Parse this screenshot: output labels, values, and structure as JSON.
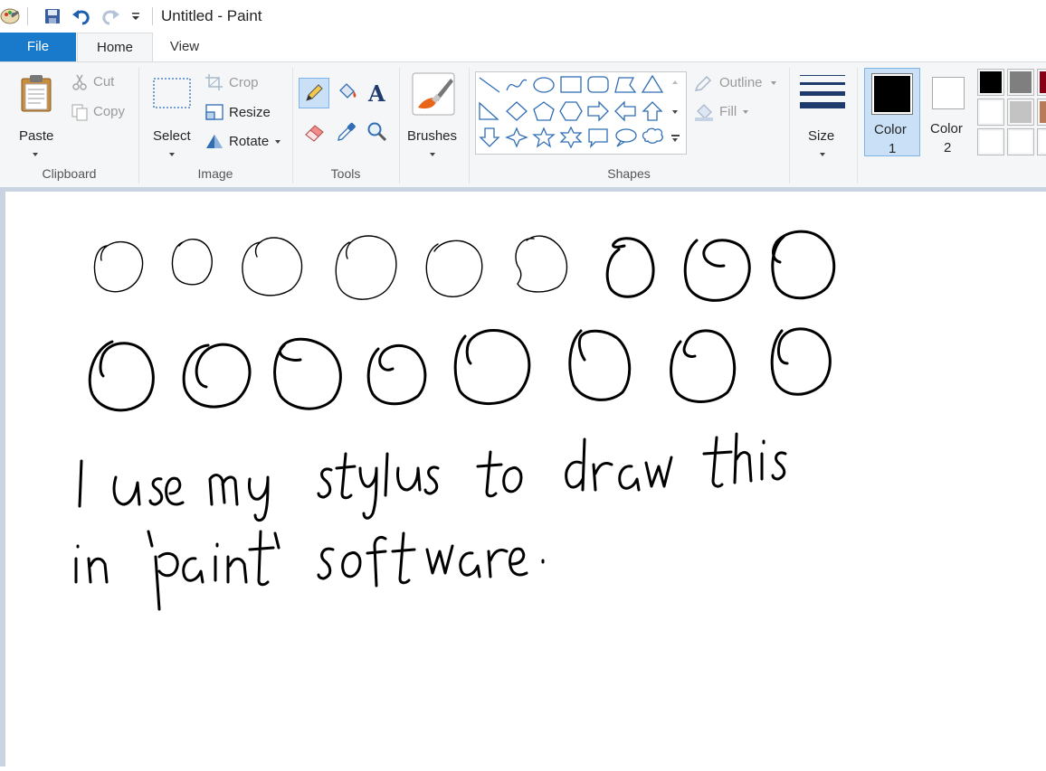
{
  "window": {
    "title": "Untitled - Paint"
  },
  "quick_access": {
    "icons": [
      "paint-app-icon",
      "save-icon",
      "undo-icon",
      "redo-icon",
      "customize-dropdown-icon"
    ]
  },
  "tabs": [
    {
      "label": "File"
    },
    {
      "label": "Home"
    },
    {
      "label": "View"
    }
  ],
  "ribbon": {
    "clipboard": {
      "group_label": "Clipboard",
      "paste": "Paste",
      "cut": "Cut",
      "copy": "Copy"
    },
    "image": {
      "group_label": "Image",
      "select": "Select",
      "crop": "Crop",
      "resize": "Resize",
      "rotate": "Rotate"
    },
    "tools": {
      "group_label": "Tools",
      "tool_icons": [
        "pencil-icon",
        "fill-bucket-icon",
        "text-icon",
        "eraser-icon",
        "color-picker-icon",
        "magnifier-icon"
      ]
    },
    "brushes": {
      "label": "Brushes"
    },
    "shapes": {
      "group_label": "Shapes",
      "outline": "Outline",
      "fill": "Fill",
      "shape_icons": [
        "line",
        "curve",
        "oval",
        "rectangle",
        "rounded-rectangle",
        "polygon",
        "triangle",
        "right-triangle",
        "diamond",
        "pentagon",
        "hexagon",
        "right-arrow",
        "left-arrow",
        "up-arrow",
        "down-arrow",
        "four-point-star",
        "five-point-star",
        "six-point-star",
        "rounded-callout",
        "oval-callout",
        "cloud-callout"
      ]
    },
    "size": {
      "label": "Size"
    },
    "color1": {
      "label_line1": "Color",
      "label_line2": "1",
      "color": "#000000"
    },
    "color2": {
      "label_line1": "Color",
      "label_line2": "2",
      "color": "#ffffff"
    },
    "palette": [
      "#000000",
      "#7f7f7f",
      "#880015",
      "#ffffff",
      "#c3c3c3",
      "#b97a57",
      "#ffffff",
      "#ffffff",
      "#ffffff"
    ]
  },
  "canvas": {
    "handwriting_line1": "I use my stylus to draw this",
    "handwriting_line2": "in 'paint' software."
  }
}
